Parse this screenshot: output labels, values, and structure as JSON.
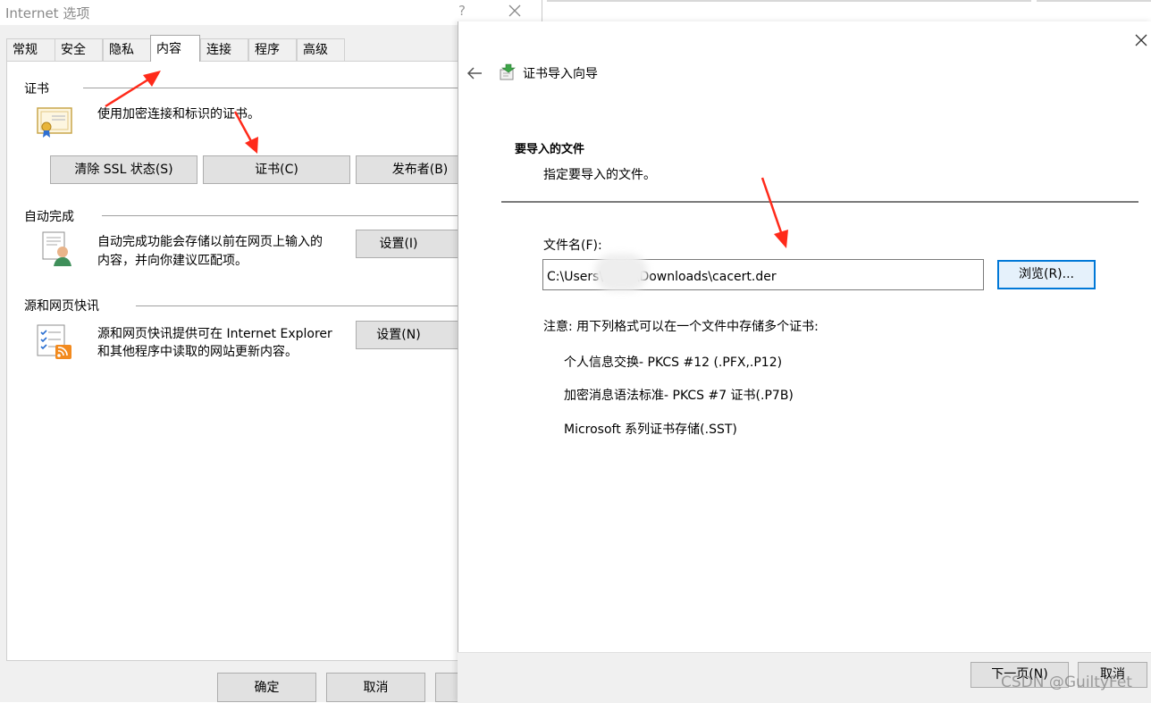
{
  "internet_options": {
    "title": "Internet 选项",
    "help": "?",
    "tabs": [
      "常规",
      "安全",
      "隐私",
      "内容",
      "连接",
      "程序",
      "高级"
    ],
    "active_tab_index": 3,
    "cert_group": {
      "label": "证书",
      "description": "使用加密连接和标识的证书。",
      "btn_clear_ssl": "清除 SSL 状态(S)",
      "btn_certificates": "证书(C)",
      "btn_publishers": "发布者(B)"
    },
    "autocomplete_group": {
      "label": "自动完成",
      "description_line1": "自动完成功能会存储以前在网页上输入的",
      "description_line2": "内容，并向你建议匹配项。",
      "btn_settings": "设置(I)"
    },
    "feeds_group": {
      "label": "源和网页快讯",
      "description_line1": "源和网页快讯提供可在 Internet Explorer",
      "description_line2": "和其他程序中读取的网站更新内容。",
      "btn_settings": "设置(N)"
    },
    "footer": {
      "ok": "确定",
      "cancel": "取消"
    }
  },
  "wizard": {
    "title": "证书导入向导",
    "heading": "要导入的文件",
    "subheading": "指定要导入的文件。",
    "file_label": "文件名(F):",
    "file_value": "C:\\Users\\        \\Downloads\\cacert.der",
    "browse_label": "浏览(R)...",
    "note": "注意: 用下列格式可以在一个文件中存储多个证书:",
    "formats": [
      "个人信息交换- PKCS #12 (.PFX,.P12)",
      "加密消息语法标准- PKCS #7 证书(.P7B)",
      "Microsoft 系列证书存储(.SST)"
    ],
    "next_label": "下一页(N)",
    "cancel_label": "取消"
  },
  "watermark": "CSDN @GuiltyFet",
  "colors": {
    "accent": "#0078d7",
    "annotation_arrow": "#ff2a1a",
    "dialog_bg": "#f0f0f0"
  },
  "icons": [
    "close-icon",
    "back-arrow-icon",
    "certificate-wizard-icon",
    "certificate-icon",
    "autocomplete-icon",
    "feed-icon"
  ]
}
